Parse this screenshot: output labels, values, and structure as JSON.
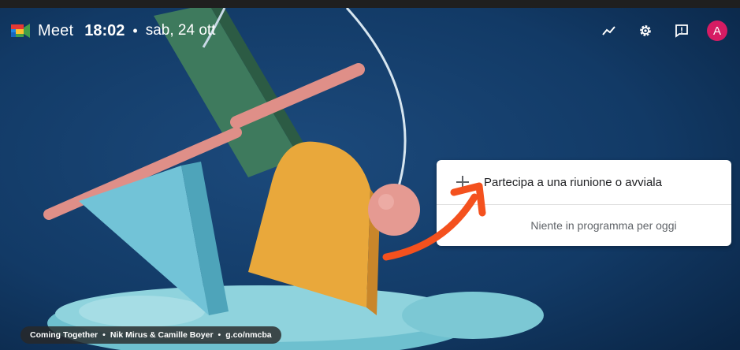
{
  "header": {
    "app_title": "Meet",
    "time": "18:02",
    "separator": "•",
    "date": "sab, 24 ott",
    "avatar_initial": "A"
  },
  "icons": {
    "logo": "google-meet-logo",
    "stats": "activity-trend-icon",
    "settings": "gear-icon",
    "feedback": "feedback-icon",
    "join": "plus-icon"
  },
  "meeting_card": {
    "join_label": "Partecipa a una riunione o avviala",
    "empty_schedule": "Niente in programma per oggi"
  },
  "background_credit": {
    "title": "Coming Together",
    "authors": "Nik Mirus & Camille Boyer",
    "link": "g.co/nmcba",
    "separator": "•"
  },
  "colors": {
    "avatar": "#d61c63",
    "annotation_arrow": "#f4511e",
    "background": "#0d2a4f"
  }
}
